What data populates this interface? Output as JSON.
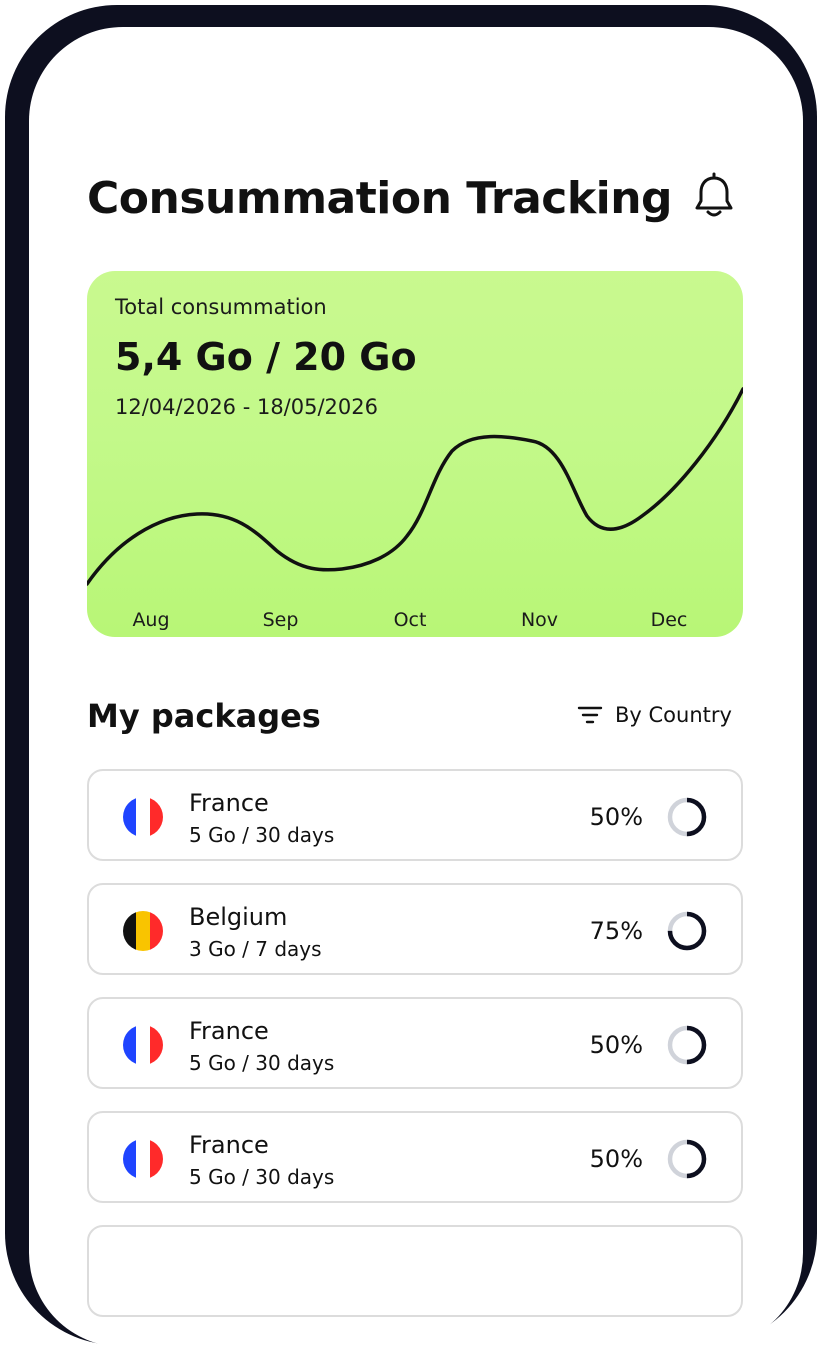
{
  "header": {
    "title": "Consummation Tracking",
    "bell_icon": "bell-icon"
  },
  "summary": {
    "label": "Total consummation",
    "value": "5,4 Go / 20 Go",
    "date_range": "12/04/2026 - 18/05/2026",
    "background_color": "#c3f98a",
    "line_color": "#111111"
  },
  "chart_data": {
    "type": "line",
    "categories": [
      "Aug",
      "Sep",
      "Oct",
      "Nov",
      "Dec"
    ],
    "x": [
      "Aug",
      "Sep",
      "Oct",
      "Nov",
      "Dec"
    ],
    "grid": false,
    "legend": "none"
  },
  "packages": {
    "title": "My packages",
    "filter_label": "By Country",
    "filter_icon": "filter-lines-icon",
    "items": [
      {
        "country": "France",
        "detail": "5 Go / 30 days",
        "percent_label": "50%",
        "progress": 0.5,
        "flag_colors": [
          "#1f44ff",
          "#ffffff",
          "#ff2a2a"
        ]
      },
      {
        "country": "Belgium",
        "detail": "3 Go / 7 days",
        "percent_label": "75%",
        "progress": 0.75,
        "flag_colors": [
          "#111111",
          "#f9c400",
          "#ff2a2a"
        ]
      },
      {
        "country": "France",
        "detail": "5 Go / 30 days",
        "percent_label": "50%",
        "progress": 0.5,
        "flag_colors": [
          "#1f44ff",
          "#ffffff",
          "#ff2a2a"
        ]
      },
      {
        "country": "France",
        "detail": "5 Go / 30 days",
        "percent_label": "50%",
        "progress": 0.5,
        "flag_colors": [
          "#1f44ff",
          "#ffffff",
          "#ff2a2a"
        ]
      },
      {
        "country": "",
        "detail": "",
        "percent_label": "",
        "progress": 0,
        "flag_colors": []
      }
    ]
  },
  "colors": {
    "frame": "#0d0f1f",
    "card_border": "#dcdcdc",
    "ring_track": "#d0d3da",
    "ring_fill": "#0d0f1f"
  }
}
